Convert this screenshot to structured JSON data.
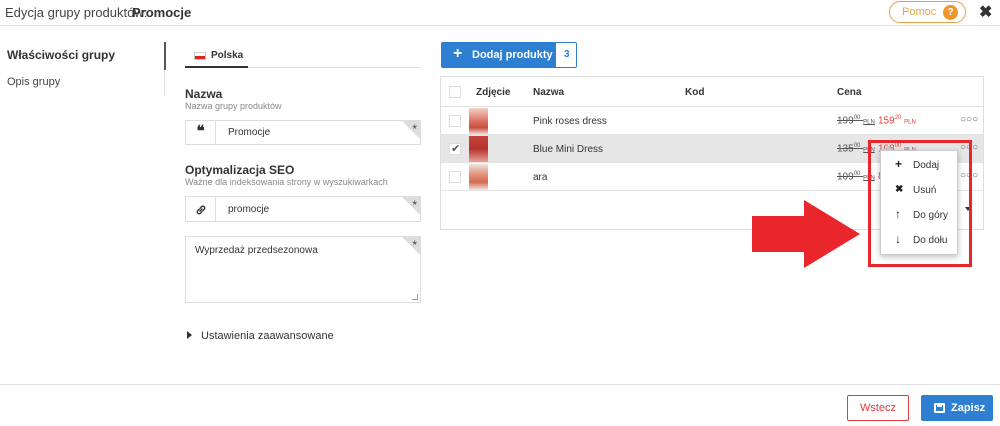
{
  "header": {
    "title_prefix": "Edycja grupy produktów:",
    "title_name": "Promocje",
    "help_label": "Pomoc",
    "help_icon": "?",
    "close_icon": "✖"
  },
  "nav": {
    "items": [
      {
        "label": "Właściwości grupy"
      },
      {
        "label": "Opis grupy"
      }
    ]
  },
  "form": {
    "language_tab": "Polska",
    "name_label": "Nazwa",
    "name_hint": "Nazwa grupy produktów",
    "name_value": "Promocje",
    "name_icon": "❝",
    "seo_label": "Optymalizacja SEO",
    "seo_hint": "Ważne dla indeksowania strony w wyszukiwarkach",
    "seo_value": "promocje",
    "seo_icon": "🔗",
    "description_value": "Wyprzedaż przedsezonowa",
    "required_mark": "*",
    "advanced_label": "Ustawienia zaawansowane"
  },
  "products": {
    "add_label": "Dodaj produkty",
    "add_icon": "+",
    "count": "3",
    "columns": [
      "Zdjęcie",
      "Nazwa",
      "Kod",
      "Cena"
    ],
    "rows": [
      {
        "name": "Pink roses dress",
        "old_price": "199",
        "old_cents": "00",
        "old_cur": "PLN",
        "new_price": "159",
        "new_cents": "20",
        "new_cur": "PLN",
        "selected": false,
        "dots": "○○○"
      },
      {
        "name": "Blue Mini Dress",
        "old_price": "135",
        "old_cents": "00",
        "old_cur": "PLN",
        "new_price": "108",
        "new_cents": "00",
        "new_cur": "PLN",
        "selected": true,
        "dots": "○○○"
      },
      {
        "name": "ara",
        "old_price": "109",
        "old_cents": "00",
        "old_cur": "PLN",
        "new_price": "8",
        "new_cents": "",
        "new_cur": "",
        "selected": false,
        "dots": "○○○"
      }
    ]
  },
  "context_menu": {
    "items": [
      {
        "label": "Dodaj",
        "icon": "+"
      },
      {
        "label": "Usuń",
        "icon": "✖"
      },
      {
        "label": "Do góry",
        "icon": "↑"
      },
      {
        "label": "Do dołu",
        "icon": "↓"
      }
    ]
  },
  "footer": {
    "back_label": "Wstecz",
    "save_label": "Zapisz"
  },
  "colors": {
    "accent": "#2c7fd1",
    "danger": "#e23b3b",
    "help": "#e6a24a",
    "annotation": "#e8262c"
  }
}
